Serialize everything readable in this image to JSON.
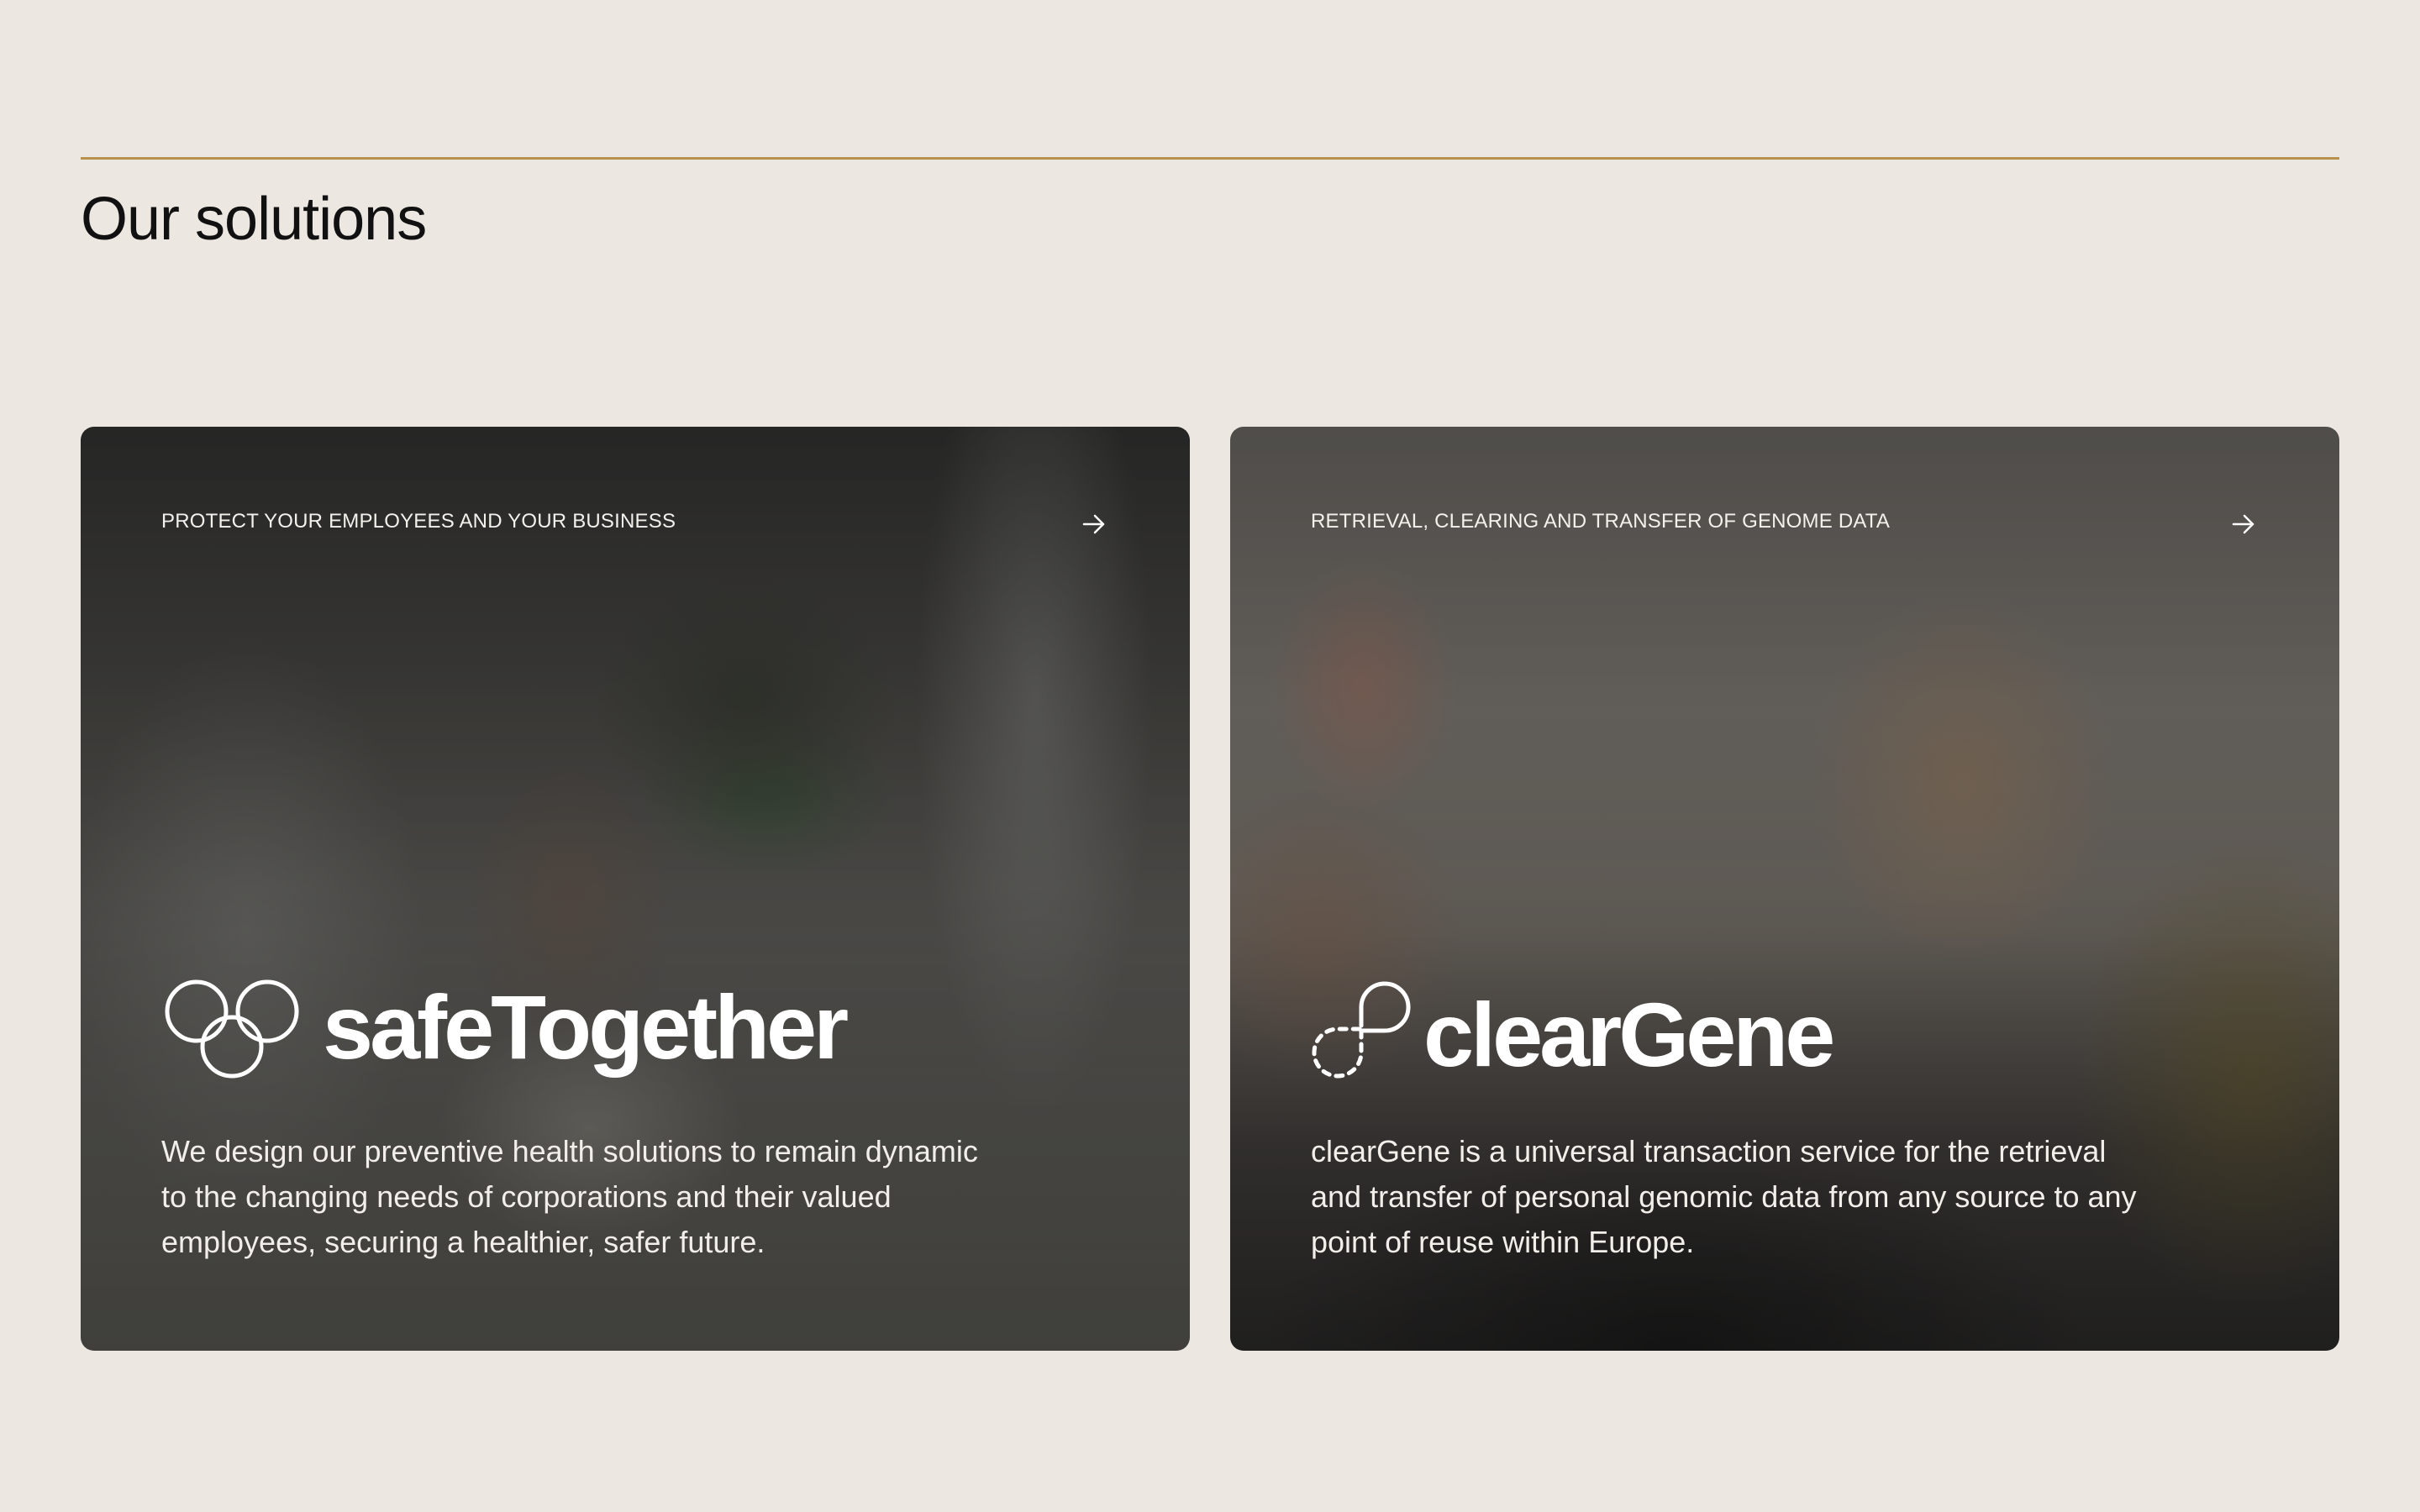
{
  "section": {
    "title": "Our solutions"
  },
  "cards": [
    {
      "eyebrow": "PROTECT YOUR EMPLOYEES AND YOUR BUSINESS",
      "brand": "safeTogether",
      "description": "We design our preventive health solutions to remain dynamic to the changing needs of corporations and their valued employees, securing a healthier, safer future.",
      "arrow_icon": "arrow-right-icon"
    },
    {
      "eyebrow": "RETRIEVAL, CLEARING AND TRANSFER OF GENOME DATA",
      "brand": "clearGene",
      "description": "clearGene is a universal transaction service for the retrieval and transfer of personal genomic data from any source to any point of reuse within Europe.",
      "arrow_icon": "arrow-right-icon"
    }
  ],
  "colors": {
    "page_background": "#ece7e0",
    "divider": "#b8924a",
    "title_text": "#111111",
    "card_text": "#ffffff"
  }
}
